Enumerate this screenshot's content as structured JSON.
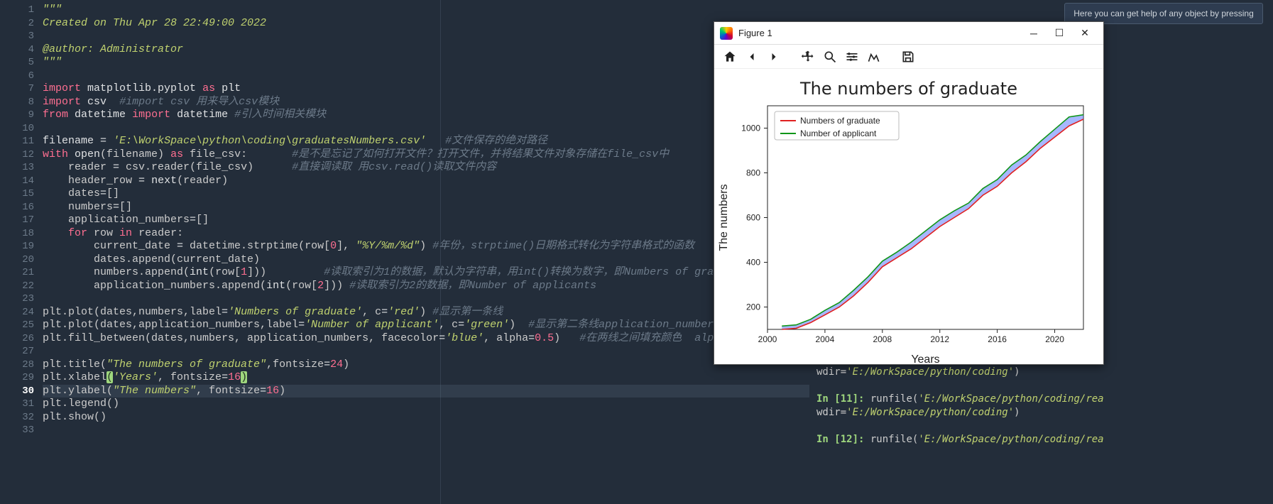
{
  "help_banner": "Here you can get help of any object by pressing",
  "editor": {
    "current_line": 30,
    "lines": [
      {
        "n": 1,
        "html": "<span class='c-doc'>\"\"\"</span>"
      },
      {
        "n": 2,
        "html": "<span class='c-doc'>Created on Thu Apr 28 22:49:00 2022</span>"
      },
      {
        "n": 3,
        "html": ""
      },
      {
        "n": 4,
        "html": "<span class='c-doc'>@author: Administrator</span>"
      },
      {
        "n": 5,
        "html": "<span class='c-doc'>\"\"\"</span>"
      },
      {
        "n": 6,
        "html": ""
      },
      {
        "n": 7,
        "html": "<span class='c-key'>import</span> <span class='c-id'>matplotlib.pyplot</span> <span class='c-key'>as</span> <span class='c-id'>plt</span>"
      },
      {
        "n": 8,
        "html": "<span class='c-key'>import</span> <span class='c-id'>csv</span>  <span class='c-com'>#import csv 用来导入csv模块</span>"
      },
      {
        "n": 9,
        "html": "<span class='c-key'>from</span> <span class='c-id'>datetime</span> <span class='c-key'>import</span> <span class='c-id'>datetime</span> <span class='c-com'>#引入时间相关模块</span>"
      },
      {
        "n": 10,
        "html": ""
      },
      {
        "n": 11,
        "html": "<span class='c-id'>filename</span> <span class='c-op'>=</span> <span class='c-str'>'E:\\WorkSpace\\python\\coding\\graduatesNumbers.csv'</span>   <span class='c-com'>#文件保存的绝对路径</span>"
      },
      {
        "n": 12,
        "html": "<span class='c-key'>with</span> <span class='c-fn'>open</span>(filename) <span class='c-key'>as</span> file_csv:       <span class='c-com'>#是不是忘记了如何打开文件？打开文件，并将结果文件对象存储在file_csv中</span>"
      },
      {
        "n": 13,
        "html": "    reader <span class='c-op'>=</span> csv.reader(file_csv)      <span class='c-com'>#直接调读取 用csv.read()读取文件内容</span>"
      },
      {
        "n": 14,
        "html": "    header_row <span class='c-op'>=</span> <span class='c-fn'>next</span>(reader)"
      },
      {
        "n": 15,
        "html": "    dates<span class='c-op'>=</span>[]"
      },
      {
        "n": 16,
        "html": "    numbers<span class='c-op'>=</span>[]"
      },
      {
        "n": 17,
        "html": "    application_numbers<span class='c-op'>=</span>[]"
      },
      {
        "n": 18,
        "html": "    <span class='c-key'>for</span> row <span class='c-key'>in</span> reader:"
      },
      {
        "n": 19,
        "html": "        current_date <span class='c-op'>=</span> datetime.strptime(row[<span class='c-num'>0</span>], <span class='c-str'>\"%Y/%m/%d\"</span>) <span class='c-com'>#年份，strptime()日期格式转化为字符串格式的函数</span>"
      },
      {
        "n": 20,
        "html": "        dates.append(current_date)"
      },
      {
        "n": 21,
        "html": "        numbers.append(<span class='c-fn'>int</span>(row[<span class='c-num'>1</span>]))         <span class='c-com'>#读取索引为1的数据，默认为字符串，用int()转换为数字，即Numbers of graduates 。</span>"
      },
      {
        "n": 22,
        "html": "        application_numbers.append(<span class='c-fn'>int</span>(row[<span class='c-num'>2</span>])) <span class='c-com'>#读取索引为2的数据，即Number of applicants</span>"
      },
      {
        "n": 23,
        "html": ""
      },
      {
        "n": 24,
        "html": "plt.plot(dates,numbers,label<span class='c-op'>=</span><span class='c-str'>'Numbers of graduate'</span>, c<span class='c-op'>=</span><span class='c-str'>'red'</span>) <span class='c-com'>#显示第一条线</span>"
      },
      {
        "n": 25,
        "html": "plt.plot(dates,application_numbers,label<span class='c-op'>=</span><span class='c-str'>'Number of applicant'</span>, c<span class='c-op'>=</span><span class='c-str'>'green'</span>)  <span class='c-com'>#显示第二条线application_numbers折线</span>"
      },
      {
        "n": 26,
        "html": "plt.fill_between(dates,numbers, application_numbers, facecolor<span class='c-op'>=</span><span class='c-str'>'blue'</span>, alpha<span class='c-op'>=</span><span class='c-num'>0.5</span>)   <span class='c-com'>#在两线之间填充颜色  alpha透明度</span>"
      },
      {
        "n": 27,
        "html": ""
      },
      {
        "n": 28,
        "html": "plt.title(<span class='c-str'>\"The numbers of graduate\"</span>,fontsize<span class='c-op'>=</span><span class='c-num'>24</span>)"
      },
      {
        "n": 29,
        "html": "plt.xlabel<span class='hl-paren'>(</span><span class='c-str'>'Years'</span>, fontsize<span class='c-op'>=</span><span class='c-num'>16</span><span class='hl-paren'>)</span>"
      },
      {
        "n": 30,
        "html": "plt.ylabel(<span class='c-str'>\"The numbers\"</span>, fontsize<span class='c-op'>=</span><span class='c-num'>16</span>)"
      },
      {
        "n": 31,
        "html": "plt.legend()"
      },
      {
        "n": 32,
        "html": "plt.show()"
      },
      {
        "n": 33,
        "html": ""
      }
    ]
  },
  "figure": {
    "window_title": "Figure 1",
    "toolbar": [
      "home",
      "back",
      "forward",
      "pan",
      "zoom",
      "configure",
      "axes",
      "save"
    ]
  },
  "chart_data": {
    "type": "line",
    "title": "The numbers of graduate",
    "xlabel": "Years",
    "ylabel": "The numbers",
    "x": [
      2001,
      2002,
      2003,
      2004,
      2005,
      2006,
      2007,
      2008,
      2009,
      2010,
      2011,
      2012,
      2013,
      2014,
      2015,
      2016,
      2017,
      2018,
      2019,
      2020,
      2021,
      2022
    ],
    "series": [
      {
        "name": "Numbers of graduate",
        "color": "#e02020",
        "values": [
          100,
          105,
          130,
          165,
          200,
          250,
          310,
          380,
          420,
          460,
          510,
          560,
          600,
          640,
          700,
          740,
          800,
          850,
          910,
          960,
          1010,
          1040
        ]
      },
      {
        "name": "Number of applicant",
        "color": "#109618",
        "values": [
          115,
          120,
          145,
          185,
          220,
          275,
          335,
          405,
          445,
          490,
          540,
          590,
          630,
          665,
          730,
          770,
          835,
          880,
          940,
          995,
          1050,
          1060
        ]
      }
    ],
    "fill_between": {
      "color": "#5070ff",
      "alpha": 0.5
    },
    "xlim": [
      2000,
      2022
    ],
    "ylim": [
      100,
      1100
    ],
    "xticks": [
      2000,
      2004,
      2008,
      2012,
      2016,
      2020
    ],
    "yticks": [
      200,
      400,
      600,
      800,
      1000
    ]
  },
  "console": {
    "lines": [
      {
        "type": "cont",
        "text": "wdir=",
        "path": "'E:/WorkSpace/python/coding'"
      },
      {
        "type": "blank"
      },
      {
        "type": "in",
        "n": 11,
        "call": "runfile(",
        "path": "'E:/WorkSpace/python/coding/readdata"
      },
      {
        "type": "cont",
        "text": "wdir=",
        "path": "'E:/WorkSpace/python/coding'"
      },
      {
        "type": "blank"
      },
      {
        "type": "in",
        "n": 12,
        "call": "runfile(",
        "path": "'E:/WorkSpace/python/coding/readdata"
      }
    ]
  }
}
